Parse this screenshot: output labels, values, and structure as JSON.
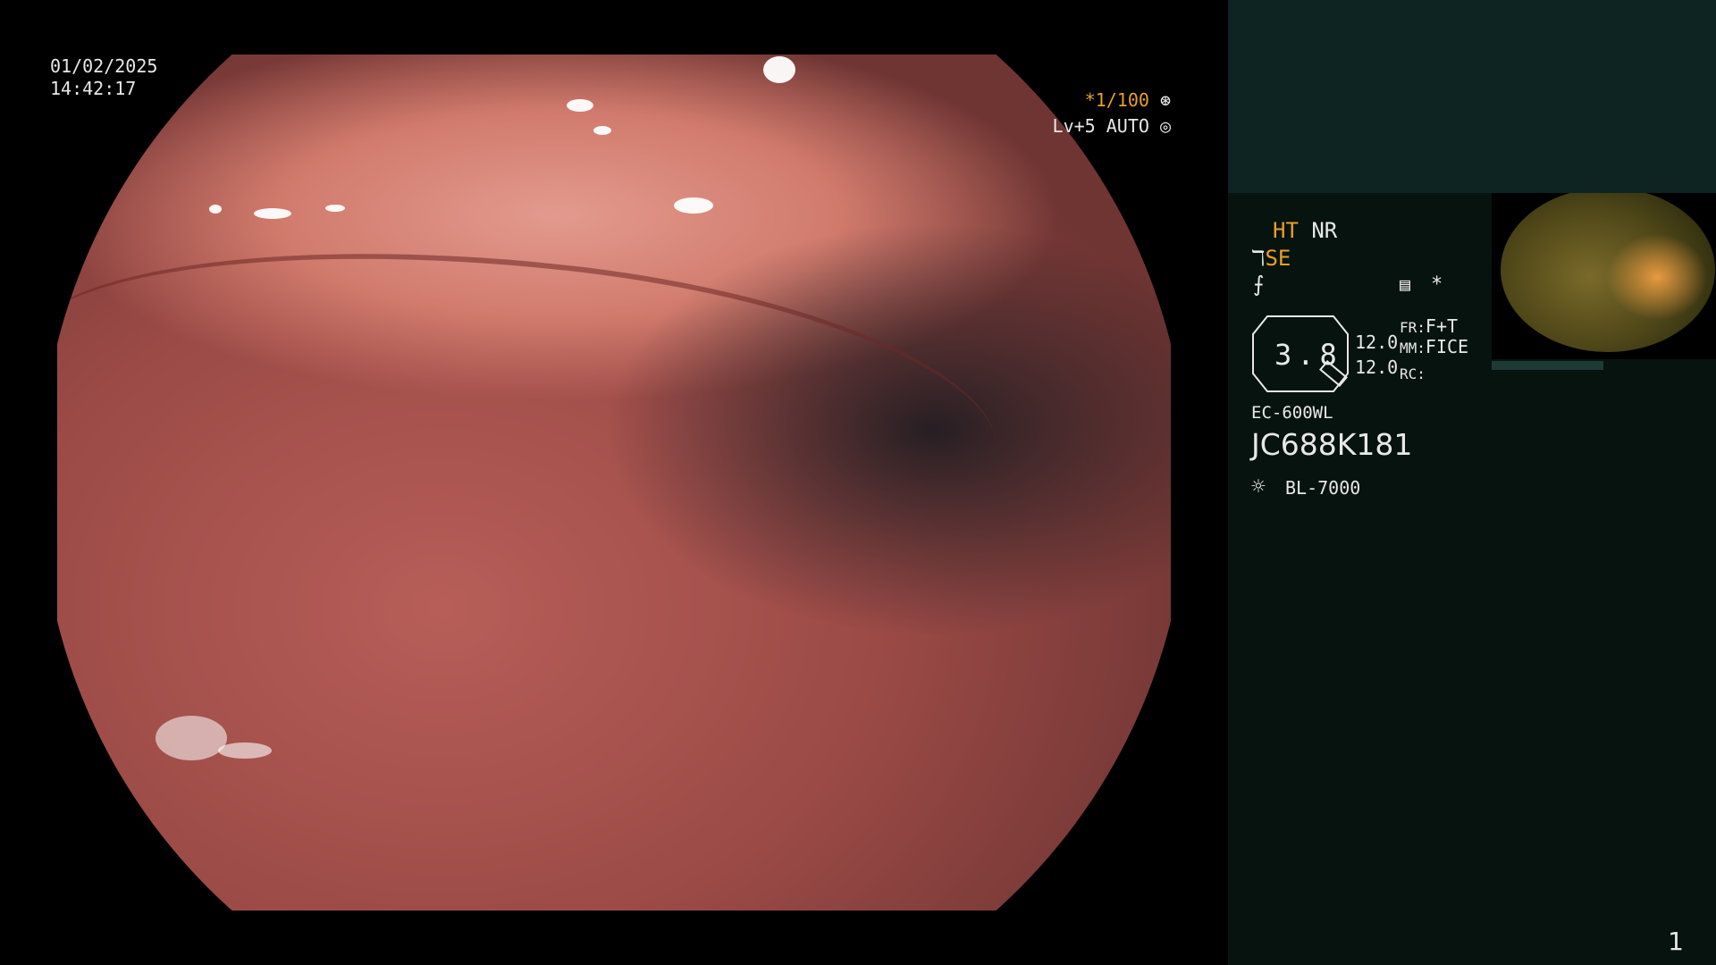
{
  "timestamp": {
    "date": "01/02/2025",
    "time": "14:42:17"
  },
  "shutter": {
    "value": "*1/100",
    "level": "Lv+5 AUTO"
  },
  "settings": {
    "ht": "HT",
    "nr": "NR",
    "se": "SE",
    "fr_label": "FR:",
    "fr_value": "F+T",
    "mm_label": "MM:",
    "mm_value": "FICE",
    "rc_label": "RC:",
    "val1": "12.0",
    "val2": "12.0",
    "zoom": "3.8"
  },
  "scope": {
    "model": "EC-600WL",
    "serial": "JC688K181",
    "light_source": "BL-7000"
  },
  "page_number": "1",
  "icons": [
    "shutter-icon",
    "auto-icon",
    "scope-icon",
    "freeze-icon",
    "memo-icon",
    "asterisk-icon",
    "lamp-icon"
  ],
  "colors": {
    "accent": "#e8a028",
    "panel_bg": "#07130f",
    "panel_top": "#0d2422"
  }
}
